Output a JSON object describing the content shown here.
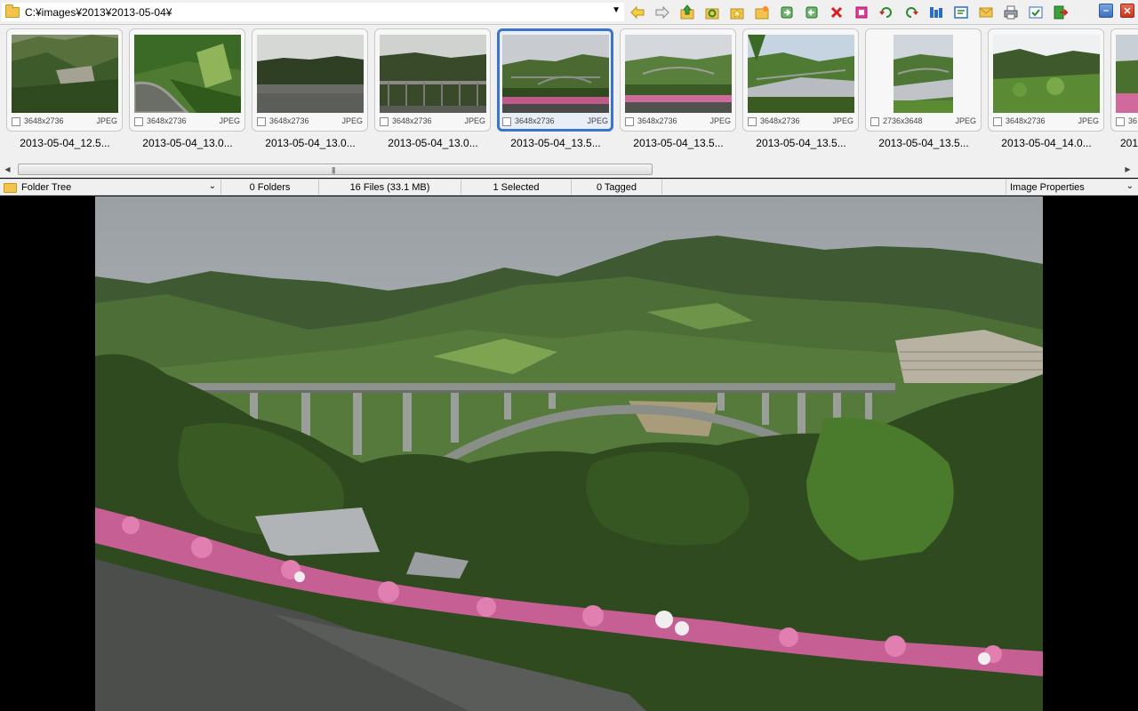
{
  "toolbar": {
    "path": "C:¥images¥2013¥2013-05-04¥",
    "icons": [
      "back-arrow-icon",
      "forward-arrow-icon",
      "up-folder-icon",
      "refresh-icon",
      "favorite-folder-icon",
      "new-folder-icon",
      "copy-to-icon",
      "move-to-icon",
      "delete-icon",
      "stop-icon",
      "rotate-left-icon",
      "rotate-right-icon",
      "compare-icon",
      "slideshow-icon",
      "email-icon",
      "print-icon",
      "properties-icon",
      "exit-icon"
    ]
  },
  "thumbnails": [
    {
      "name": "2013-05-04_12.5...",
      "dims": "3648x2736",
      "format": "JPEG",
      "selected": false
    },
    {
      "name": "2013-05-04_13.0...",
      "dims": "3648x2736",
      "format": "JPEG",
      "selected": false
    },
    {
      "name": "2013-05-04_13.0...",
      "dims": "3648x2736",
      "format": "JPEG",
      "selected": false
    },
    {
      "name": "2013-05-04_13.0...",
      "dims": "3648x2736",
      "format": "JPEG",
      "selected": false
    },
    {
      "name": "2013-05-04_13.5...",
      "dims": "3648x2736",
      "format": "JPEG",
      "selected": true
    },
    {
      "name": "2013-05-04_13.5...",
      "dims": "3648x2736",
      "format": "JPEG",
      "selected": false
    },
    {
      "name": "2013-05-04_13.5...",
      "dims": "3648x2736",
      "format": "JPEG",
      "selected": false
    },
    {
      "name": "2013-05-04_13.5...",
      "dims": "2736x3648",
      "format": "JPEG",
      "selected": false
    },
    {
      "name": "2013-05-04_14.0...",
      "dims": "3648x2736",
      "format": "JPEG",
      "selected": false
    },
    {
      "name": "201",
      "dims": "36",
      "format": "",
      "selected": false
    }
  ],
  "status": {
    "folder_tree": "Folder Tree",
    "folders": "0 Folders",
    "files": "16 Files (33.1 MB)",
    "selected": "1 Selected",
    "tagged": "0 Tagged",
    "image_properties": "Image Properties"
  },
  "colors": {
    "selection_border": "#3b74c9",
    "toolbar_bg": "#f0f0f0"
  }
}
